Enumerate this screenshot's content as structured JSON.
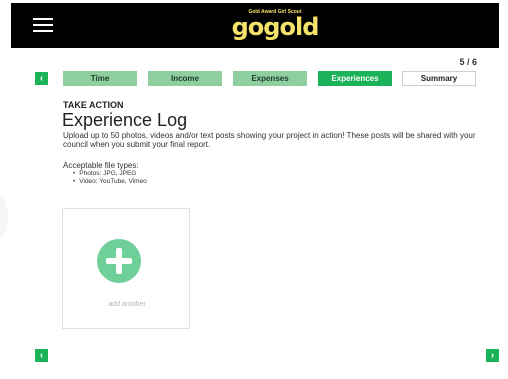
{
  "header": {
    "logo_tagline": "Gold Award Girl Scout",
    "logo_text": "gogold"
  },
  "progress": {
    "step_label": "5 / 6"
  },
  "tabs": [
    {
      "label": "Time",
      "state": "done"
    },
    {
      "label": "Income",
      "state": "done"
    },
    {
      "label": "Expenses",
      "state": "done"
    },
    {
      "label": "Experiences",
      "state": "active"
    },
    {
      "label": "Summary",
      "state": "todo"
    }
  ],
  "main": {
    "eyebrow": "TAKE ACTION",
    "title": "Experience Log",
    "description": "Upload up to 50 photos, videos and/or text posts showing your project in action! These posts will be shared with your council when you submit your final report.",
    "acceptable_label": "Acceptable file types:",
    "acceptable_types": [
      "Photos: JPG, JPEG",
      "Video: YouTube, Vimeo"
    ],
    "add_label": "add another"
  },
  "icons": {
    "menu": "hamburger-icon",
    "prev": "chevron-left-icon",
    "next": "chevron-right-icon",
    "add": "plus-circle-icon"
  },
  "colors": {
    "brand_green": "#1bb25a",
    "tab_done": "#8fce9f",
    "logo_gold": "#f5e26b",
    "header_bg": "#000000"
  }
}
